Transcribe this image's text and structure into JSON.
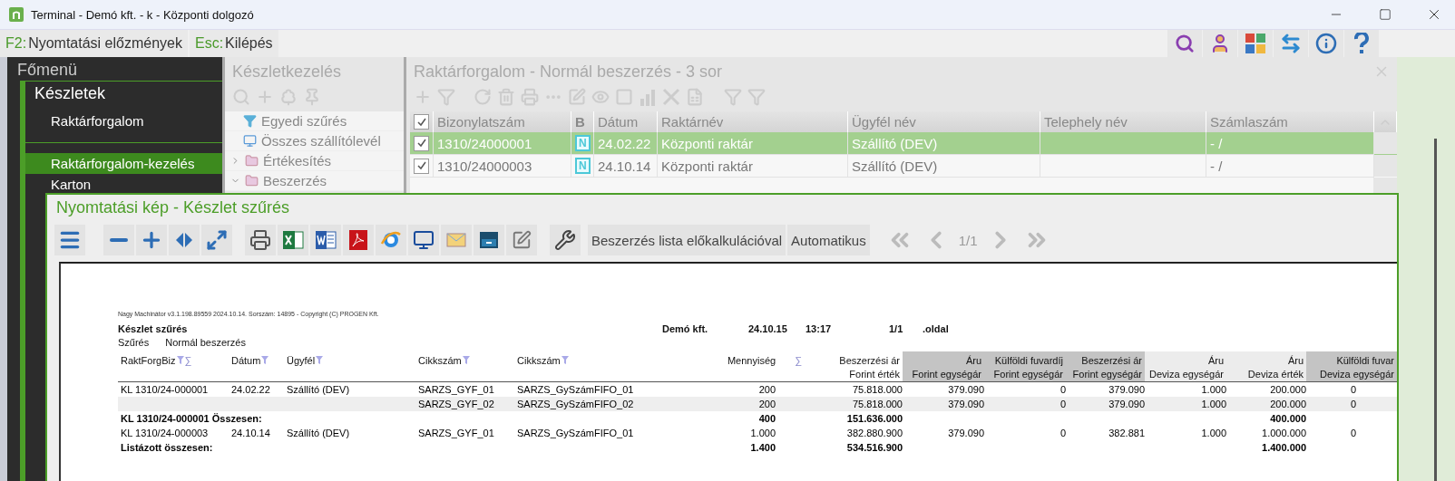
{
  "window": {
    "title": "Terminal - Demó kft. - k - Központi dolgozó"
  },
  "shortcuts": [
    {
      "key": "F2:",
      "label": "Nyomtatási előzmények"
    },
    {
      "key": "Esc:",
      "label": "Kilépés"
    }
  ],
  "main_menu": {
    "title": "Főmenü",
    "section": "Készletek",
    "group": "Raktárforgalom",
    "items": [
      {
        "label": "Raktárforgalom-kezelés",
        "selected": true
      },
      {
        "label": "Karton",
        "selected": false
      }
    ]
  },
  "inventory_panel": {
    "title": "Készletkezelés",
    "tree": [
      {
        "label": "Egyedi szűrés",
        "kind": "view"
      },
      {
        "label": "Összes szállítólevél",
        "kind": "view"
      },
      {
        "label": "Értékesítés",
        "kind": "folder",
        "expanded": false
      },
      {
        "label": "Beszerzés",
        "kind": "folder",
        "expanded": true
      }
    ]
  },
  "movements_panel": {
    "title": "Raktárforgalom - Normál beszerzés - 3 sor",
    "header_checked": true,
    "columns": [
      "Bizonylatszám",
      "B",
      "Dátum",
      "Raktárnév",
      "Ügyfél név",
      "Telephely név",
      "Számlaszám"
    ],
    "rows": [
      {
        "selected": true,
        "checked": true,
        "cells": [
          "1310/24000001",
          "N",
          "24.02.22",
          "Központi raktár",
          "Szállító (DEV)",
          null,
          "-  /"
        ]
      },
      {
        "selected": false,
        "checked": true,
        "cells": [
          "1310/24000003",
          "N",
          "24.10.14",
          "Központi raktár",
          "Szállító (DEV)",
          null,
          "-  /"
        ]
      }
    ]
  },
  "print_preview": {
    "title": "Nyomtatási kép - Készlet szűrés",
    "buttons": [
      "Beszerzés lista előkalkulációval",
      "Automatikus"
    ],
    "page": "1/1",
    "report": {
      "meta": "Nagy Machinátor v3.1.198.89559 2024.10.14. Sorszám: 14895 - Copyright (C) PROGEN Kft.",
      "title": "Készlet szűrés",
      "company": "Demó kft.",
      "date": "24.10.15",
      "time": "13:17",
      "page": "1/1",
      "page_label": ".oldal",
      "filter_label": "Szűrés",
      "filter_value": "Normál beszerzés",
      "columns": [
        {
          "lines": [
            "RaktForgBiz"
          ],
          "filter": true,
          "sum": "∑",
          "kind": "text"
        },
        {
          "lines": [
            "Dátum"
          ],
          "filter": true,
          "kind": "text"
        },
        {
          "lines": [
            "Ügyfél"
          ],
          "filter": true,
          "kind": "text"
        },
        {
          "lines": [
            "Cikkszám"
          ],
          "filter": true,
          "kind": "text"
        },
        {
          "lines": [
            "Cikkszám"
          ],
          "filter": true,
          "kind": "text"
        },
        {
          "lines": [
            "Mennyiség"
          ],
          "filter": false,
          "sum": "∑",
          "kind": "number"
        },
        {
          "lines": [
            "Beszerzési ár",
            "Forint érték"
          ],
          "filter": false,
          "kind": "number"
        },
        {
          "lines": [
            "Áru",
            "Forint egységár"
          ],
          "filter": false,
          "kind": "number",
          "color": "#c4c4c4"
        },
        {
          "lines": [
            "Külföldi fuvardíj",
            "Forint egységár"
          ],
          "filter": false,
          "kind": "number",
          "color": "#c4c4c4"
        },
        {
          "lines": [
            "Beszerzési ár",
            "Forint egységár"
          ],
          "filter": false,
          "kind": "number",
          "color": "#c4c4c4"
        },
        {
          "lines": [
            "Áru",
            "Deviza egységár"
          ],
          "filter": false,
          "kind": "number",
          "color": "#ececec"
        },
        {
          "lines": [
            "Áru",
            "Deviza érték"
          ],
          "filter": false,
          "kind": "number",
          "color": "#ececec"
        },
        {
          "lines": [
            "Külföldi fuvar",
            "Deviza egységár"
          ],
          "filter": false,
          "kind": "number",
          "color": "#c4c4c4"
        }
      ],
      "rows": [
        {
          "kind": "item",
          "shaded": false,
          "cells": [
            "KL 1310/24-000001",
            "24.02.22",
            "Szállító (DEV)",
            "SARZS_GYF_01",
            "SARZS_GySzámFIFO_01",
            "200",
            "75.818.000",
            "379.090",
            "0",
            "379.090",
            "1.000",
            "200.000",
            "0"
          ]
        },
        {
          "kind": "item",
          "shaded": true,
          "cells": [
            null,
            null,
            null,
            "SARZS_GYF_02",
            "SARZS_GySzámFIFO_02",
            "200",
            "75.818.000",
            "379.090",
            "0",
            "379.090",
            "1.000",
            "200.000",
            "0"
          ]
        },
        {
          "kind": "total",
          "label": "KL 1310/24-000001 Összesen:",
          "cells": [
            null,
            null,
            null,
            null,
            null,
            "400",
            "151.636.000",
            null,
            null,
            null,
            null,
            "400.000",
            null
          ]
        },
        {
          "kind": "item",
          "shaded": false,
          "cells": [
            "KL 1310/24-000003",
            "24.10.14",
            "Szállító (DEV)",
            "SARZS_GYF_01",
            "SARZS_GySzámFIFO_01",
            "1.000",
            "382.880.900",
            "379.090",
            "0",
            "382.881",
            "1.000",
            "1.000.000",
            "0"
          ]
        },
        {
          "kind": "total",
          "label": "Listázott összesen:",
          "cells": [
            null,
            null,
            null,
            null,
            null,
            "1.400",
            "534.516.900",
            null,
            null,
            null,
            null,
            "1.400.000",
            null
          ]
        }
      ]
    }
  }
}
